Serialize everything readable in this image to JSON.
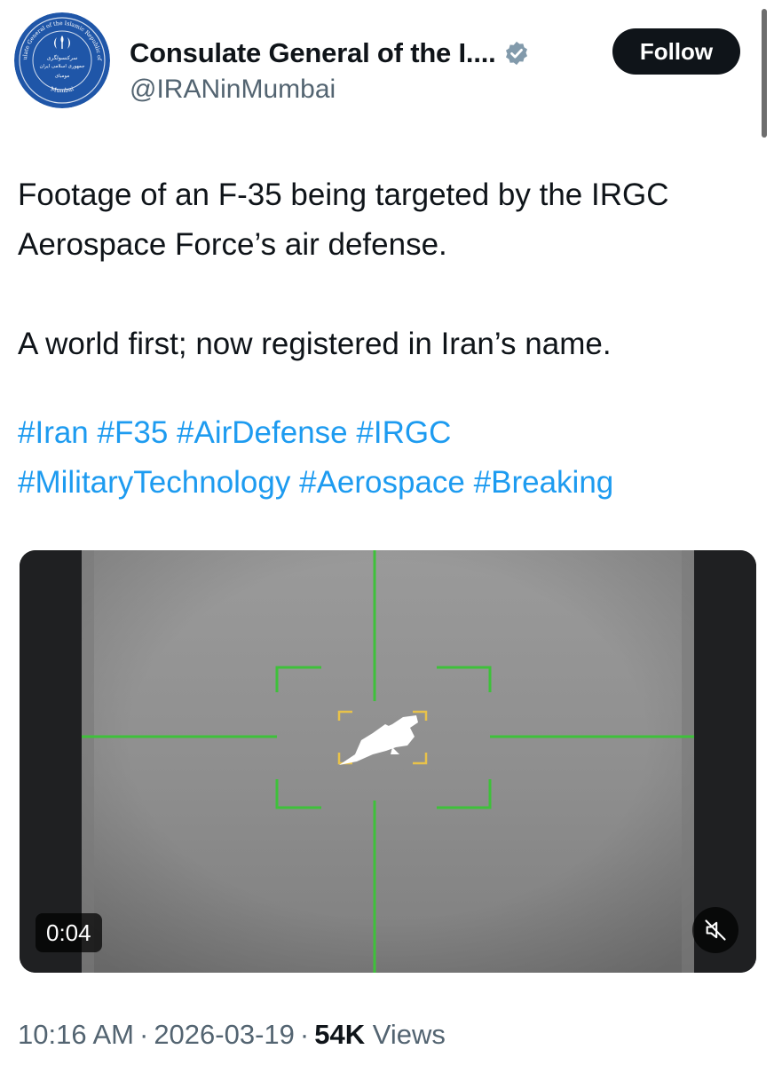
{
  "author": {
    "display_name": "Consulate General of the I....",
    "handle": "@IRANinMumbai",
    "verified": true,
    "avatar_emblem_text": {
      "ring_top": "Consulate General of the Islamic Republic of Iran",
      "ring_bottom": "Mumbai",
      "center_fa_line1": "سرکنسولگری",
      "center_fa_line2": "جمهوری اسلامی ایران",
      "center_fa_line3": "مومبای"
    },
    "avatar_color": "#1f56a8",
    "verified_badge_color": "#829aab"
  },
  "follow_button": {
    "label": "Follow",
    "background": "#0f1419"
  },
  "tweet": {
    "text_line1": "Footage of an F-35 being targeted by the IRGC",
    "text_line2": "Aerospace Force’s air defense.",
    "text_line3": "A world first; now registered in Iran’s name.",
    "hashtags_row1": [
      "#Iran",
      "#F35",
      "#AirDefense",
      "#IRGC"
    ],
    "hashtags_row2": [
      "#MilitaryTechnology",
      "#Aerospace",
      "#Breaking"
    ],
    "hashtag_color": "#1d9bf0"
  },
  "video": {
    "duration": "0:04",
    "mute_icon": "speaker-muted-icon",
    "reticle_color": "#3ec13a",
    "target_box_color": "#e8c24a"
  },
  "meta": {
    "time": "10:16 AM",
    "separator": "·",
    "date": "2026-03-19",
    "views_count": "54K",
    "views_label": "Views"
  }
}
